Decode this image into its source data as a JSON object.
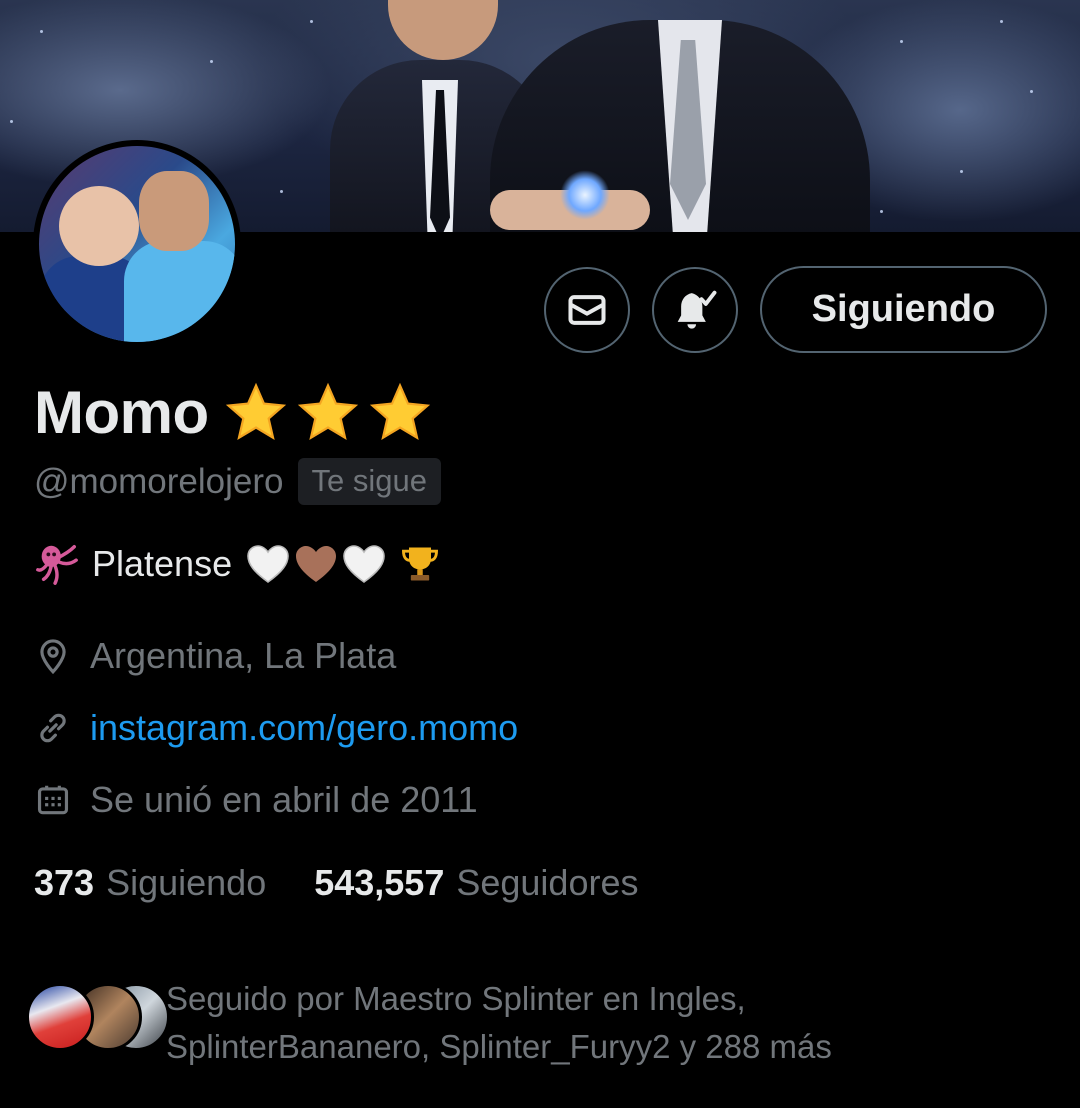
{
  "profile": {
    "name": "Momo",
    "handle": "@momorelojero",
    "follows_you": "Te sigue",
    "bio_text": "Platense",
    "location": "Argentina, La Plata",
    "website": "instagram.com/gero.momo",
    "joined": "Se unió en abril de 2011"
  },
  "actions": {
    "follow_label": "Siguiendo",
    "message_icon": "mail-icon",
    "notify_icon": "bell-check-icon"
  },
  "stats": {
    "following_count": "373",
    "following_label": "Siguiendo",
    "followers_count": "543,557",
    "followers_label": "Seguidores"
  },
  "followed_by": {
    "line1": "Seguido por Maestro Splinter en Ingles,",
    "line2": "SplinterBananero, Splinter_Furyy2 y 288 más"
  },
  "colors": {
    "background": "#000000",
    "text": "#e7e9ea",
    "muted": "#71767b",
    "link": "#1d9bf0",
    "border": "#536471",
    "star": "#ffcc33"
  }
}
